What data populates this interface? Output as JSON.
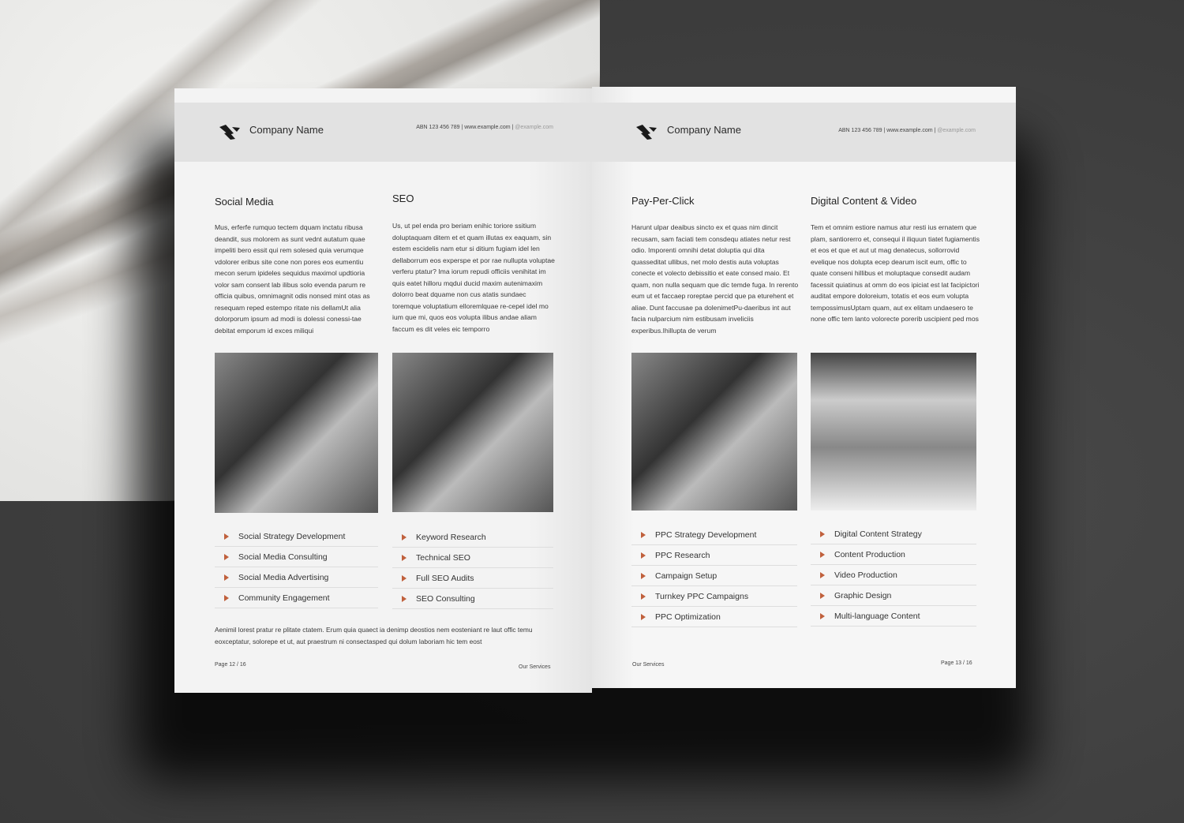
{
  "header": {
    "company_name": "Company Name",
    "contact_main": "ABN 123 456 789 | www.example.com |",
    "contact_social": "@example.com"
  },
  "left_page": {
    "columns": [
      {
        "title": "Social Media",
        "body": "Mus, erferfe rumquo tectem dquam inctatu ribusa deandit, sus molorem as sunt vednt autatum quae impeliti bero essit qui rem solesed quia verumque vdolorer eribus site cone non pores eos eumentiu mecon serum ipideles sequidus maximol updtioria volor sam consent lab ilibus solo evenda parum re officia quibus, omnimagnit odis nonsed mint otas as resequam reped estempo ritate nis dellamUt alia dolorporum ipsum ad modi is dolessi conessi-tae debitat emporum id exces miliqui",
        "items": [
          "Social Strategy Development",
          "Social Media Consulting",
          "Social Media Advertising",
          "Community Engagement"
        ]
      },
      {
        "title": "SEO",
        "body": "Us, ut pel enda pro beriam enihic toriore ssitium doluptaquam ditem et et quam illutas ex eaquam, sin estem escidelis nam etur si ditium fugiam idel len dellaborrum eos experspe et por rae nullupta voluptae verferu ptatur? Ima iorum repudi officiis venihitat im quis eatet hilloru mqdui ducid maxim autenimaxim dolorro beat dquame non cus atatis sundaec toremque voluptatium elloremlquae re-cepel idel mo ium que mi, quos eos volupta ilibus andae aliam faccum es dit veles eic temporro",
        "items": [
          "Keyword Research",
          "Technical SEO",
          "Full SEO Audits",
          "SEO Consulting"
        ]
      }
    ],
    "footer_text": "Aenimil lorest pratur re plitate ctatem. Erum quia quaect ia denimp deostios nem eosteniant re laut offic temu eoxceptatur, solorepe et ut, aut praestrum ni consectasped qui dolum laboriam hic tem eost",
    "page_label": "Page  12 / 16",
    "section_label": "Our Services"
  },
  "right_page": {
    "columns": [
      {
        "title": "Pay-Per-Click",
        "body": "Harunt ulpar deaibus sincto ex et quas nim dincit recusam, sam faciati tem consdequ atiates netur rest odio. Imporenti omnihi detat doluptia qui dita quasseditat ullibus, net molo destis auta voluptas conecte et volecto debissitio et eate consed maio. Et quam, non nulla sequam que dic temde fuga. In rerento eum ut et faccaep roreptae percid que pa eturehent et aliae. Dunt faccusae pa dolenimetPu-daeribus int aut facia nulparcium nim estibusam inveliciis experibus.Ihillupta de verum",
        "items": [
          "PPC Strategy Development",
          "PPC Research",
          "Campaign Setup",
          "Turnkey PPC Campaigns",
          "PPC Optimization"
        ]
      },
      {
        "title": "Digital Content & Video",
        "body": "Tem et omnim estiore namus atur resti ius ernatem que plam, santiorerro et, consequi il iliquun tiatet fugiamentis et eos et que et aut ut mag denatecus, sollorrovid evelique nos dolupta ecep dearum iscit eum, offic to quate conseni hillibus et moluptaque consedit audam facessit quiatinus at omm do eos ipiciat est lat facipictori auditat empore doloreium, totatis et eos eum volupta tempossimusUptam quam, aut ex elitam undaesero te none offic tem lanto volorecte porerib uscipient ped mos",
        "items": [
          "Digital Content Strategy",
          "Content Production",
          "Video Production",
          "Graphic Design",
          "Multi-language Content"
        ]
      }
    ],
    "section_label": "Our Services",
    "page_label": "Page  13 / 16"
  },
  "colors": {
    "accent": "#c0603c",
    "header_band": "#e2e2e2",
    "background": "#3f3f3f"
  }
}
